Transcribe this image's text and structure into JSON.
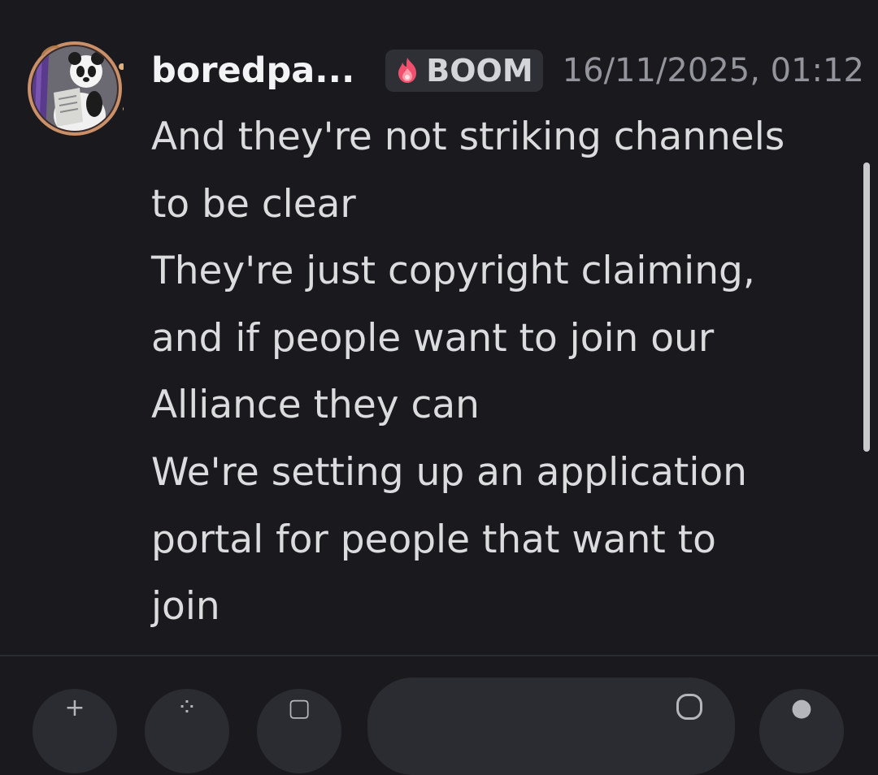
{
  "message": {
    "username": "boredpa...",
    "role": {
      "icon": "fire-icon",
      "label": "BOOM",
      "color": "#f0506e"
    },
    "timestamp": "16/11/2025, 01:12",
    "lines": [
      "And they're not striking channels",
      "to be clear",
      "They're just copyright claiming,",
      "and if people want to join our",
      "Alliance they can",
      "We're setting up an application",
      "portal for people that want to",
      "join"
    ],
    "avatar": {
      "icon": "panda-reading-newspaper-avatar"
    }
  },
  "bottom_bar": {
    "buttons": [
      {
        "icon": "add-icon"
      },
      {
        "icon": "apps-icon"
      },
      {
        "icon": "gift-icon"
      }
    ],
    "input": {
      "icon": "emoji-icon"
    },
    "right_button": {
      "icon": "mic-icon"
    }
  },
  "colors": {
    "background": "#1a1a1e",
    "text": "#dbdcde",
    "username": "#f2f3f5",
    "timestamp": "#94959c",
    "role_background": "#2f3036"
  }
}
